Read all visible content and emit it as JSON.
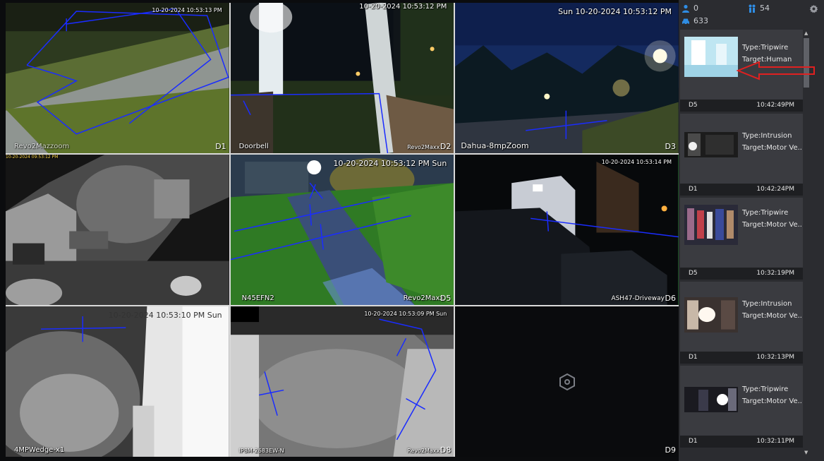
{
  "header_stats": {
    "people_count": "0",
    "group_count": "54",
    "vehicle_count": "633"
  },
  "cameras": [
    {
      "id": "D1",
      "name": "Revo2Mazzoom",
      "timestamp": "10-20-2024 10:53:13 PM"
    },
    {
      "id": "D2",
      "name": "Doorbell",
      "timestamp": "10-20-2024 10:53:12 PM",
      "name2": "Revo2Maxx"
    },
    {
      "id": "D3",
      "name": "Dahua-8mpZoom",
      "timestamp": "Sun 10-20-2024 10:53:12 PM"
    },
    {
      "id": "",
      "name": "",
      "timestamp": "10-20-2024 09:53:12 PM"
    },
    {
      "id": "D5",
      "name": "N45EFN2",
      "timestamp": "10-20-2024 10:53:12 PM Sun",
      "name2": "Revo2Maxx"
    },
    {
      "id": "D6",
      "name": "ASH47-Driveway",
      "timestamp": "10-20-2024 10:53:14 PM"
    },
    {
      "id": "",
      "name": "4MPWedge-x1",
      "timestamp": "10-20-2024 10:53:10 PM Sun"
    },
    {
      "id": "D8",
      "name": "IP8M-2683EW-N",
      "timestamp": "10-20-2024 10:53:09 PM Sun",
      "name2": "Revo2Maxx"
    },
    {
      "id": "D9",
      "name": "",
      "timestamp": ""
    }
  ],
  "alarms": [
    {
      "type": "Type:Tripwire",
      "target": "Target:Human",
      "channel": "D5",
      "time": "10:42:49PM"
    },
    {
      "type": "Type:Intrusion",
      "target": "Target:Motor Ve...",
      "channel": "D1",
      "time": "10:42:24PM"
    },
    {
      "type": "Type:Tripwire",
      "target": "Target:Motor Ve...",
      "channel": "D5",
      "time": "10:32:19PM"
    },
    {
      "type": "Type:Intrusion",
      "target": "Target:Motor Ve...",
      "channel": "D1",
      "time": "10:32:13PM"
    },
    {
      "type": "Type:Tripwire",
      "target": "Target:Motor Ve...",
      "channel": "D1",
      "time": "10:32:11PM"
    }
  ],
  "icons": {
    "people": "person-icon",
    "group": "group-icon",
    "vehicle": "car-icon",
    "settings": "gear-icon",
    "no_video": "hexagon-camera-icon"
  },
  "colors": {
    "rule_line": "#1a2cff",
    "selected_border": "#3bd14a",
    "stat_icon": "#2f8de4",
    "annotation_arrow": "#e02020"
  }
}
